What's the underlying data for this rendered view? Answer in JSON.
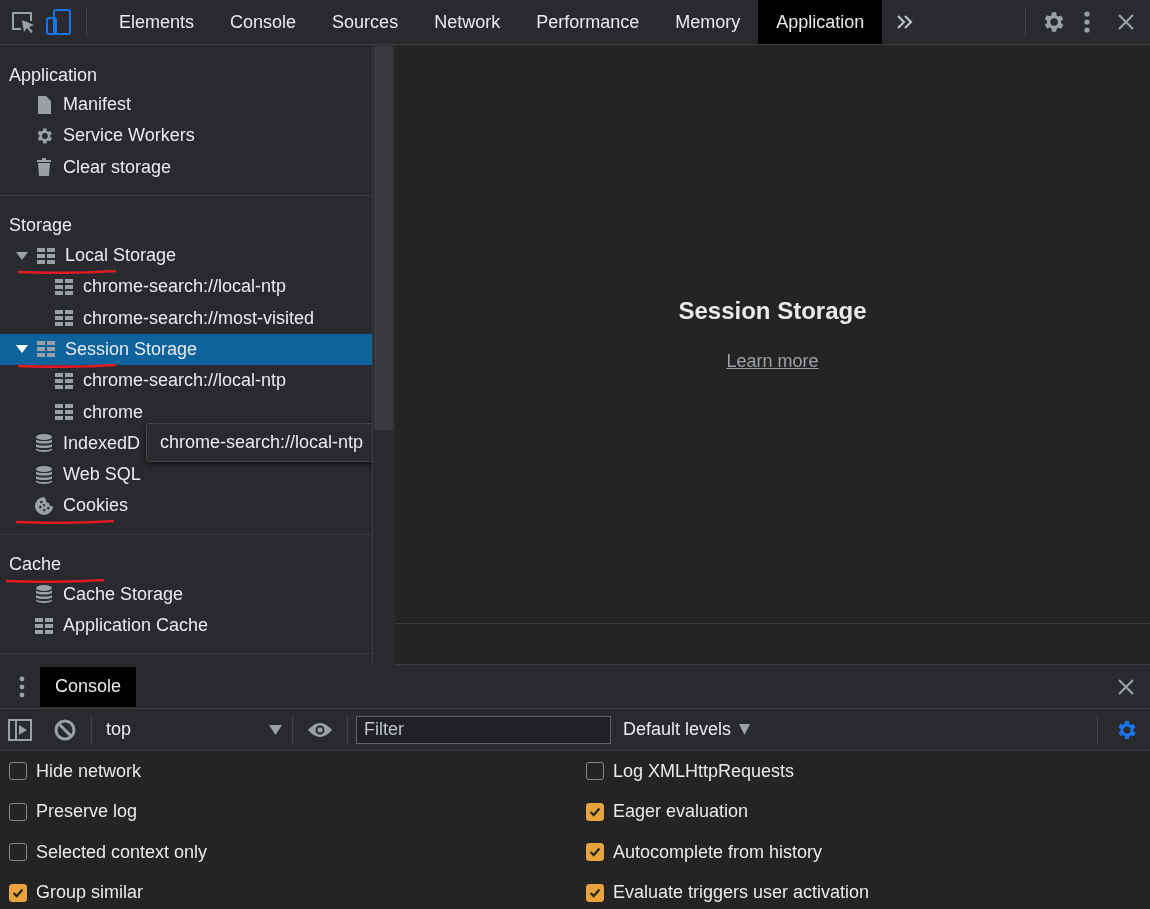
{
  "toolbar": {
    "tabs": [
      {
        "label": "Elements",
        "selected": false
      },
      {
        "label": "Console",
        "selected": false
      },
      {
        "label": "Sources",
        "selected": false
      },
      {
        "label": "Network",
        "selected": false
      },
      {
        "label": "Performance",
        "selected": false
      },
      {
        "label": "Memory",
        "selected": false
      },
      {
        "label": "Application",
        "selected": true
      }
    ],
    "device_mode": {
      "on": true
    }
  },
  "sidebar": {
    "sections": [
      {
        "title": "Application",
        "underlined": false,
        "items": [
          {
            "label": "Manifest",
            "kind": "document",
            "selected": false,
            "underlined": false
          },
          {
            "label": "Service Workers",
            "kind": "gear",
            "selected": false,
            "underlined": false
          },
          {
            "label": "Clear storage",
            "kind": "trash",
            "selected": false,
            "underlined": false
          }
        ]
      },
      {
        "title": "Storage",
        "underlined": false,
        "items": [
          {
            "label": "Local Storage",
            "kind": "table",
            "selected": false,
            "underlined": true,
            "expanded": true,
            "children": [
              {
                "label": "chrome-search://local-ntp",
                "kind": "table",
                "selected": false,
                "underlined": false
              },
              {
                "label": "chrome-search://most-visited",
                "kind": "table",
                "selected": false,
                "underlined": false
              }
            ]
          },
          {
            "label": "Session Storage",
            "kind": "table",
            "selected": true,
            "underlined": true,
            "expanded": true,
            "children": [
              {
                "label": "chrome-search://local-ntp",
                "kind": "table",
                "selected": false,
                "underlined": false
              },
              {
                "label": "chrome",
                "kind": "table",
                "selected": false,
                "underlined": false
              }
            ]
          },
          {
            "label": "IndexedD",
            "kind": "database",
            "selected": false,
            "underlined": false
          },
          {
            "label": "Web SQL",
            "kind": "database",
            "selected": false,
            "underlined": false
          },
          {
            "label": "Cookies",
            "kind": "cookie",
            "selected": false,
            "underlined": true
          }
        ]
      },
      {
        "title": "Cache",
        "underlined": true,
        "items": [
          {
            "label": "Cache Storage",
            "kind": "database",
            "selected": false,
            "underlined": false
          },
          {
            "label": "Application Cache",
            "kind": "table",
            "selected": false,
            "underlined": false
          }
        ]
      }
    ],
    "tooltip": "chrome-search://local-ntp"
  },
  "main": {
    "title": "Session Storage",
    "link": "Learn more"
  },
  "drawer": {
    "tabs": [
      {
        "label": "Console",
        "selected": true
      }
    ],
    "context": "top",
    "filter": {
      "placeholder": "Filter"
    },
    "levels": "Default levels",
    "settings": [
      {
        "label": "Hide network",
        "checked": false
      },
      {
        "label": "Log XMLHttpRequests",
        "checked": false
      },
      {
        "label": "Preserve log",
        "checked": false
      },
      {
        "label": "Eager evaluation",
        "checked": true
      },
      {
        "label": "Selected context only",
        "checked": false
      },
      {
        "label": "Autocomplete from history",
        "checked": true
      },
      {
        "label": "Group similar",
        "checked": true
      },
      {
        "label": "Evaluate triggers user activation",
        "checked": true
      }
    ]
  }
}
